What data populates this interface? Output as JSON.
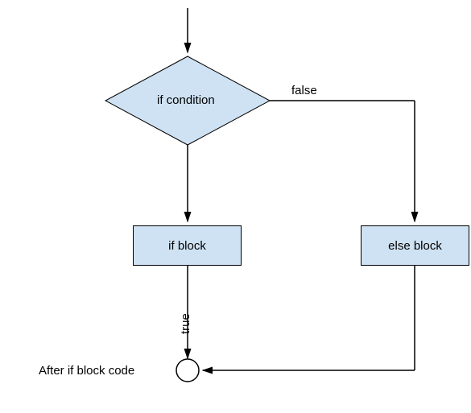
{
  "condition": "if condition",
  "if_block": "if block",
  "else_block": "else block",
  "false_label": "false",
  "true_label": "true",
  "after_label": "After if block code"
}
